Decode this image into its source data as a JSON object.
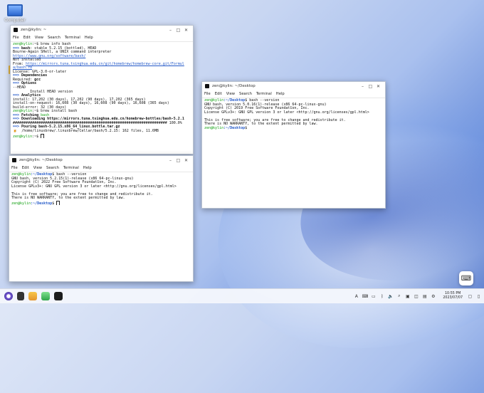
{
  "desktop": {
    "icon_label": "Computer"
  },
  "window1": {
    "title": "zen@kylin: ~",
    "menu": [
      "File",
      "Edit",
      "View",
      "Search",
      "Terminal",
      "Help"
    ],
    "lines": [
      [
        {
          "t": "zen@kylin",
          "c": "g"
        },
        {
          "t": ":~$ brew info bash"
        }
      ],
      [
        {
          "t": "==> ",
          "c": "b"
        },
        {
          "t": "bash",
          "c": "k"
        },
        {
          "t": ": stable 5.2.15 (bottled), HEAD"
        }
      ],
      [
        {
          "t": "Bourne-Again SHell, a UNIX command interpreter"
        }
      ],
      [
        {
          "t": "https://www.gnu.org/software/bash/",
          "c": "u"
        }
      ],
      [
        {
          "t": "Not installed"
        }
      ],
      [
        {
          "t": "From: "
        },
        {
          "t": "https://mirrors.tuna.tsinghua.edu.cn/git/homebrew/homebrew-core.git/Formul",
          "c": "u"
        }
      ],
      [
        {
          "t": "a/bash.rb",
          "c": "u"
        }
      ],
      [
        {
          "t": "License: GPL-3.0-or-later"
        }
      ],
      [
        {
          "t": "==> ",
          "c": "b"
        },
        {
          "t": "Dependencies",
          "c": "k"
        }
      ],
      [
        {
          "t": "Required: "
        },
        {
          "t": "gcc",
          "c": "k"
        }
      ],
      [
        {
          "t": "==> ",
          "c": "b"
        },
        {
          "t": "Options",
          "c": "k"
        }
      ],
      [
        {
          "t": "--HEAD"
        }
      ],
      [
        {
          "t": "        Install HEAD version"
        }
      ],
      [
        {
          "t": "==> ",
          "c": "b"
        },
        {
          "t": "Analytics",
          "c": "k"
        }
      ],
      [
        {
          "t": "install: 17,202 (30 days), 17,202 (90 days), 17,202 (365 days)"
        }
      ],
      [
        {
          "t": "install-on-request: 16,608 (30 days), 16,608 (90 days), 16,608 (365 days)"
        }
      ],
      [
        {
          "t": "build-error: 32 (30 days)"
        }
      ],
      [
        {
          "t": "zen@kylin",
          "c": "g"
        },
        {
          "t": ":~$ brew install bash"
        }
      ],
      [
        {
          "t": "==> ",
          "c": "b"
        },
        {
          "t": "Fetching ",
          "c": "k"
        },
        {
          "t": "bash",
          "c": "g"
        }
      ],
      [
        {
          "t": "==> ",
          "c": "b"
        },
        {
          "t": "Downloading https://mirrors.tuna.tsinghua.edu.cn/homebrew-bottles/bash-5.2.1",
          "c": "k"
        }
      ],
      [
        {
          "t": "######################################################################## 100.0%"
        }
      ],
      [
        {
          "t": "==> ",
          "c": "b"
        },
        {
          "t": "Pouring bash-5.2.15.x86_64_linux.bottle.tar.gz",
          "c": "k"
        }
      ],
      [
        {
          "t": "🍺  /home/linuxbrew/.linuxbrew/Cellar/bash/5.2.15: 162 files, 11.6MB"
        }
      ],
      [
        {
          "t": "zen@kylin",
          "c": "g"
        },
        {
          "t": ":~$ "
        },
        {
          "cursor": true
        }
      ]
    ]
  },
  "window2": {
    "title": "zen@kylin: ~/Desktop",
    "menu": [
      "File",
      "Edit",
      "View",
      "Search",
      "Terminal",
      "Help"
    ],
    "lines": [
      [
        {
          "t": "zen@kylin",
          "c": "g"
        },
        {
          "t": ":~/Desktop",
          "c": "b"
        },
        {
          "t": "$ bash --version"
        }
      ],
      [
        {
          "t": "GNU bash, version 5.2.15(1)-release (x86_64-pc-linux-gnu)"
        }
      ],
      [
        {
          "t": "Copyright (C) 2022 Free Software Foundation, Inc."
        }
      ],
      [
        {
          "t": "License GPLv3+: GNU GPL version 3 or later <http://gnu.org/licenses/gpl.html>"
        }
      ],
      [
        {
          "t": ""
        }
      ],
      [
        {
          "t": "This is free software; you are free to change and redistribute it."
        }
      ],
      [
        {
          "t": "There is NO WARRANTY, to the extent permitted by law."
        }
      ],
      [
        {
          "t": "zen@kylin",
          "c": "g"
        },
        {
          "t": ":~/Desktop",
          "c": "b"
        },
        {
          "t": "$ "
        },
        {
          "cursor": true
        }
      ]
    ]
  },
  "window3": {
    "title": "zen@kylin: ~/Desktop",
    "menu": [
      "File",
      "Edit",
      "View",
      "Search",
      "Terminal",
      "Help"
    ],
    "lines": [
      [
        {
          "t": "zen@kylin",
          "c": "g"
        },
        {
          "t": ":~/Desktop",
          "c": "b"
        },
        {
          "t": "$ bash --version"
        }
      ],
      [
        {
          "t": "GNU bash, version 5.0.16(1)-release (x86_64-pc-linux-gnu)"
        }
      ],
      [
        {
          "t": "Copyright (C) 2019 Free Software Foundation, Inc."
        }
      ],
      [
        {
          "t": "License GPLv3+: GNU GPL version 3 or later <http://gnu.org/licenses/gpl.html>"
        }
      ],
      [
        {
          "t": ""
        }
      ],
      [
        {
          "t": "This is free software; you are free to change and redistribute it."
        }
      ],
      [
        {
          "t": "There is NO WARRANTY, to the extent permitted by law."
        }
      ],
      [
        {
          "t": "zen@kylin",
          "c": "g"
        },
        {
          "t": ":~/Desktop",
          "c": "b"
        },
        {
          "t": "$"
        }
      ]
    ]
  },
  "taskbar": {
    "time": "10:55 PM",
    "date": "2023/07/07",
    "tray_icons": [
      "input-method-icon",
      "keyboard-icon",
      "network-icon",
      "bluetooth-icon",
      "volume-icon",
      "search-icon",
      "clipboard-icon",
      "screenshot-icon",
      "wallet-icon",
      "settings-icon",
      "notification-icon",
      "display-icon"
    ],
    "apps": [
      "start-menu-icon",
      "task-view-icon",
      "file-manager-icon",
      "software-center-icon",
      "terminal-icon"
    ]
  }
}
